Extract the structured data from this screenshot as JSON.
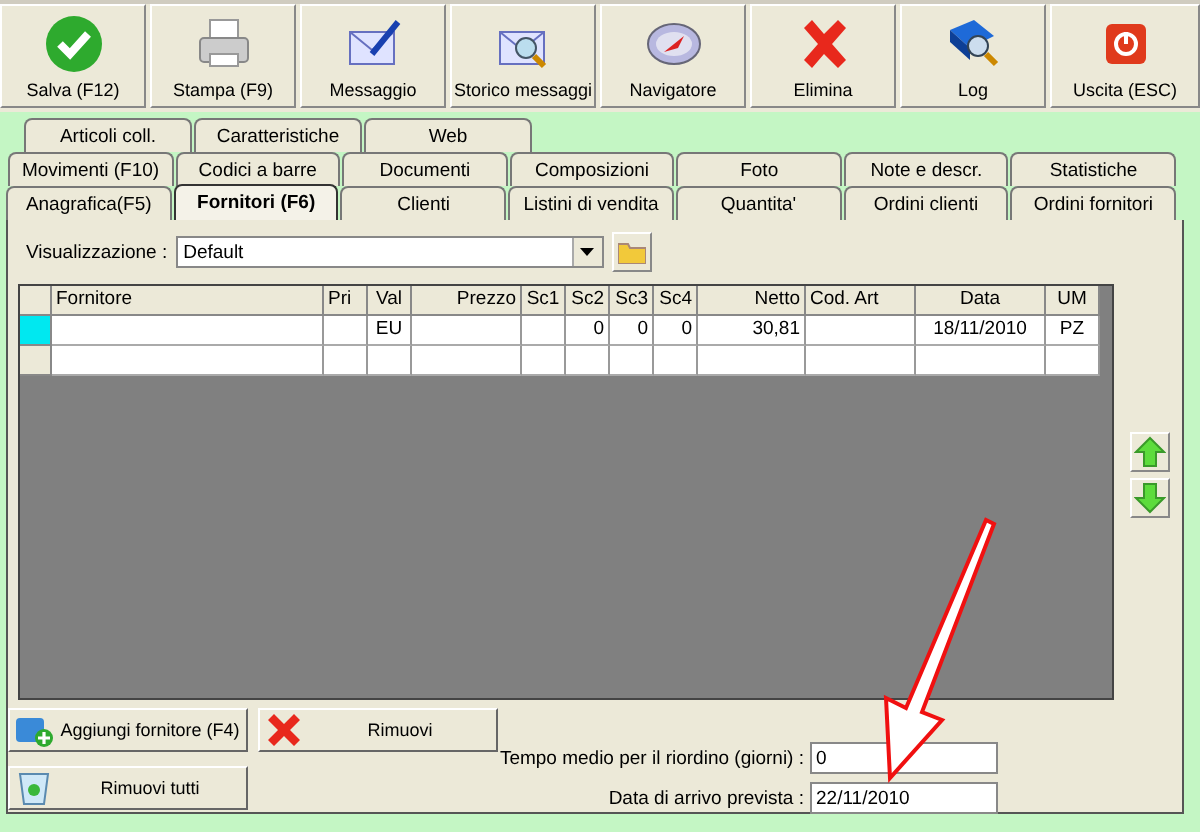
{
  "toolbar": [
    {
      "label": "Salva (F12)"
    },
    {
      "label": "Stampa (F9)"
    },
    {
      "label": "Messaggio"
    },
    {
      "label": "Storico messaggi"
    },
    {
      "label": "Navigatore"
    },
    {
      "label": "Elimina"
    },
    {
      "label": "Log"
    },
    {
      "label": "Uscita (ESC)"
    }
  ],
  "tab_rows": [
    [
      {
        "label": "Articoli coll.",
        "selected": false
      },
      {
        "label": "Caratteristiche",
        "selected": false
      },
      {
        "label": "Web",
        "selected": false
      }
    ],
    [
      {
        "label": "Movimenti (F10)",
        "selected": false
      },
      {
        "label": "Codici a barre",
        "selected": false
      },
      {
        "label": "Documenti",
        "selected": false
      },
      {
        "label": "Composizioni",
        "selected": false
      },
      {
        "label": "Foto",
        "selected": false
      },
      {
        "label": "Note e descr.",
        "selected": false
      },
      {
        "label": "Statistiche",
        "selected": false
      }
    ],
    [
      {
        "label": "Anagrafica(F5)",
        "selected": false
      },
      {
        "label": "Fornitori (F6)",
        "selected": true
      },
      {
        "label": "Clienti",
        "selected": false
      },
      {
        "label": "Listini di vendita",
        "selected": false
      },
      {
        "label": "Quantita'",
        "selected": false
      },
      {
        "label": "Ordini clienti",
        "selected": false
      },
      {
        "label": "Ordini fornitori",
        "selected": false
      }
    ]
  ],
  "view": {
    "label": "Visualizzazione :",
    "value": "Default"
  },
  "table": {
    "columns": [
      {
        "label": "Fornitore"
      },
      {
        "label": "Pri"
      },
      {
        "label": "Val"
      },
      {
        "label": "Prezzo"
      },
      {
        "label": "Sc1"
      },
      {
        "label": "Sc2"
      },
      {
        "label": "Sc3"
      },
      {
        "label": "Sc4"
      },
      {
        "label": "Netto"
      },
      {
        "label": "Cod. Art"
      },
      {
        "label": "Data"
      },
      {
        "label": "UM"
      }
    ],
    "rows": [
      {
        "selected": true,
        "cells": [
          "",
          "",
          "EU",
          "",
          "",
          "0",
          "0",
          "0",
          "30,81",
          "",
          "18/11/2010",
          "PZ"
        ]
      },
      {
        "selected": false,
        "cells": [
          "",
          "",
          "",
          "",
          "",
          "",
          "",
          "",
          "",
          "",
          "",
          ""
        ]
      }
    ]
  },
  "buttons": [
    {
      "label": "Aggiungi fornitore (F4)"
    },
    {
      "label": "Rimuovi"
    },
    {
      "label": "Rimuovi tutti"
    }
  ],
  "fields": [
    {
      "label": "Tempo medio per il riordino (giorni) :",
      "value": "0"
    },
    {
      "label": "Data di arrivo prevista :",
      "value": "22/11/2010"
    }
  ]
}
